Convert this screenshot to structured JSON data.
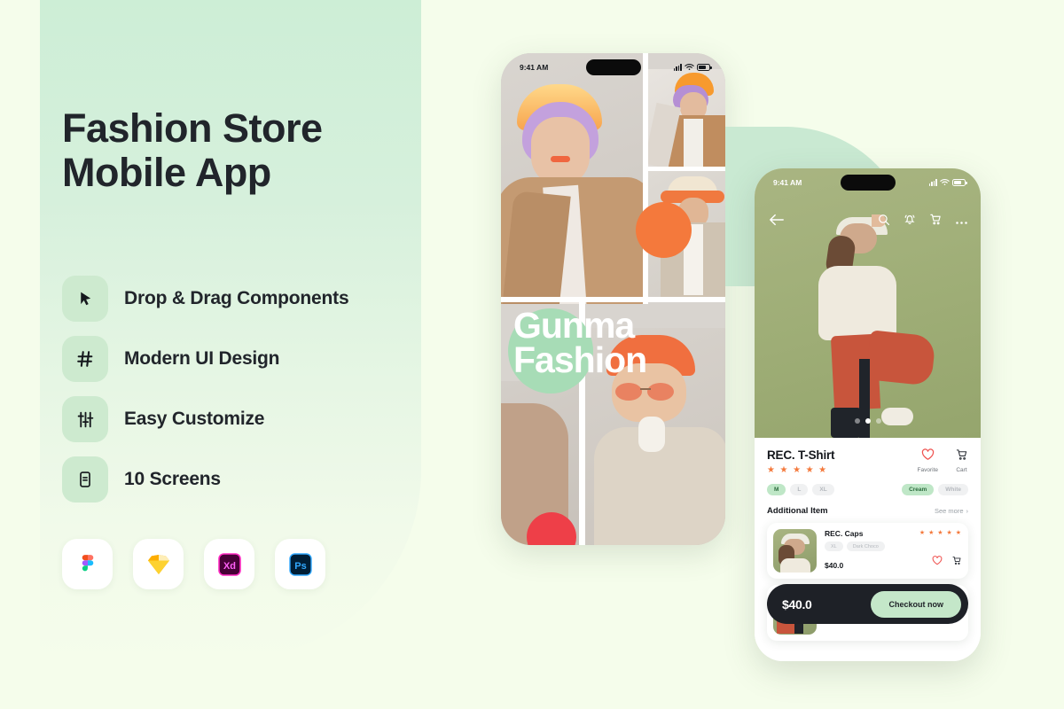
{
  "page": {
    "background_color": "#f5fdeb",
    "panel_gradient_top": "#cdeed6",
    "accent_green": "#bfe7c7",
    "accent_orange": "#f4793c",
    "accent_red": "#ee3f48",
    "dark": "#1e2127"
  },
  "left_panel": {
    "headline_line1": "Fashion Store",
    "headline_line2": "Mobile App",
    "features": [
      {
        "icon": "cursor-icon",
        "label": "Drop & Drag Components"
      },
      {
        "icon": "hash-icon",
        "label": "Modern UI Design"
      },
      {
        "icon": "sliders-icon",
        "label": "Easy Customize"
      },
      {
        "icon": "mobile-screen-icon",
        "label": "10 Screens"
      }
    ],
    "apps": [
      {
        "name": "figma-logo",
        "label": "Figma"
      },
      {
        "name": "sketch-logo",
        "label": "Sketch"
      },
      {
        "name": "adobe-xd-logo",
        "label": "Xd"
      },
      {
        "name": "photoshop-logo",
        "label": "Ps"
      }
    ]
  },
  "phone_left": {
    "status": {
      "time": "9:41 AM",
      "signal": "signal-icon",
      "wifi": "wifi-icon",
      "battery": "battery-icon"
    },
    "hero_line1": "Gunma",
    "hero_line2": "Fashion"
  },
  "phone_right": {
    "status": {
      "time": "9:41 AM",
      "signal": "signal-icon",
      "wifi": "wifi-icon",
      "battery": "battery-icon"
    },
    "nav": {
      "back": "back-arrow-icon",
      "icons": [
        "search-icon",
        "bell-icon",
        "cart-icon",
        "more-icon"
      ]
    },
    "carousel": {
      "total": 3,
      "active": 2
    },
    "product": {
      "title": "REC. T-Shirt",
      "rating": "★ ★ ★ ★ ★",
      "favorite_label": "Favorite",
      "cart_label": "Cart",
      "sizes": [
        {
          "label": "M",
          "selected": true
        },
        {
          "label": "L",
          "selected": false
        },
        {
          "label": "XL",
          "selected": false
        }
      ],
      "colors": [
        {
          "label": "Cream",
          "selected": true
        },
        {
          "label": "White",
          "selected": false
        }
      ]
    },
    "additional": {
      "title": "Additional Item",
      "see_more": "See more",
      "chevron": "›",
      "items": [
        {
          "name": "REC. Caps",
          "rating": "★ ★ ★ ★ ★",
          "chips": [
            "XL",
            "Dark Choco"
          ],
          "price": "$40.0"
        }
      ]
    },
    "checkout": {
      "price": "$40.0",
      "button": "Checkout now"
    }
  }
}
